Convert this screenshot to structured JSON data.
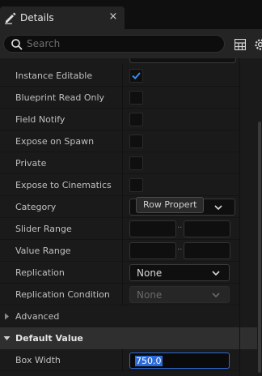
{
  "tab": {
    "title": "Details",
    "close": "×"
  },
  "search": {
    "placeholder": "Search",
    "value": ""
  },
  "properties": [
    {
      "label": "Instance Editable",
      "type": "checkbox",
      "checked": true
    },
    {
      "label": "Blueprint Read Only",
      "type": "checkbox",
      "checked": false
    },
    {
      "label": "Field Notify",
      "type": "checkbox",
      "checked": false
    },
    {
      "label": "Expose on Spawn",
      "type": "checkbox",
      "checked": false
    },
    {
      "label": "Private",
      "type": "checkbox",
      "checked": false
    },
    {
      "label": "Expose to Cinematics",
      "type": "checkbox",
      "checked": false
    },
    {
      "label": "Category",
      "type": "category",
      "value": "Row Propert"
    },
    {
      "label": "Slider Range",
      "type": "range"
    },
    {
      "label": "Value Range",
      "type": "range"
    },
    {
      "label": "Replication",
      "type": "combo",
      "value": "None"
    },
    {
      "label": "Replication Condition",
      "type": "combo",
      "value": "None",
      "disabled": true
    }
  ],
  "advanced": {
    "label": "Advanced",
    "expanded": false
  },
  "default_value": {
    "label": "Default Value",
    "expanded": true
  },
  "box_width": {
    "label": "Box Width",
    "value": "750.0"
  },
  "colors": {
    "accent": "#2d6bd8",
    "panel": "#1a1a1a",
    "header": "#2f2f2f"
  }
}
